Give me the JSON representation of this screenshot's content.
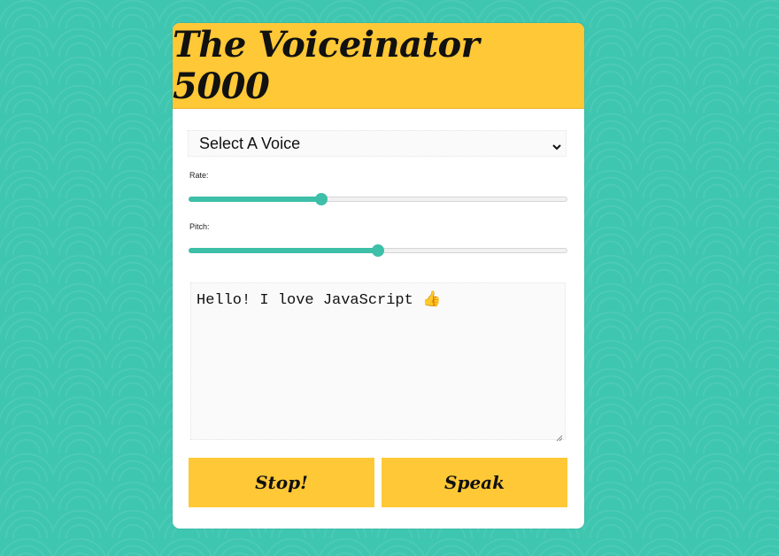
{
  "app": {
    "title": "The Voiceinator 5000"
  },
  "voice_select": {
    "selected": "Select A Voice",
    "icon": "chevron-down-icon"
  },
  "rate": {
    "label": "Rate:",
    "value_fraction": 0.35
  },
  "pitch": {
    "label": "Pitch:",
    "value_fraction": 0.5
  },
  "text": {
    "value": "Hello! I love JavaScript 👍"
  },
  "buttons": {
    "stop_label": "Stop!",
    "speak_label": "Speak"
  },
  "colors": {
    "background": "#3ec6b0",
    "accent": "#ffc836",
    "slider": "#3dbfa8"
  }
}
